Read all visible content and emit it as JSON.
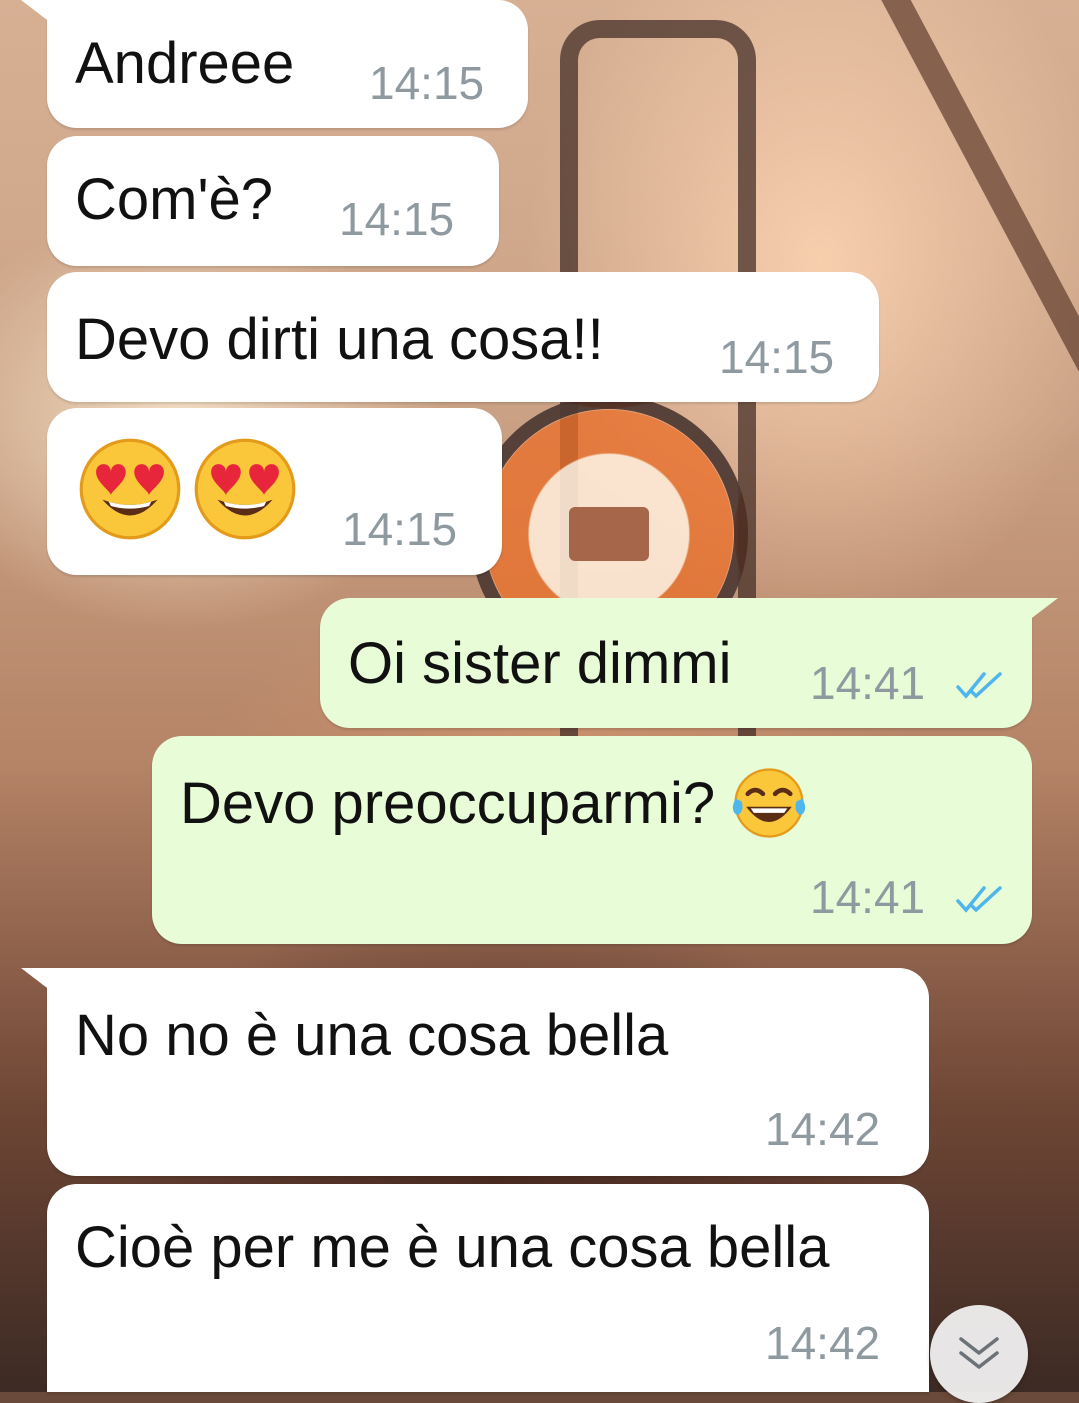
{
  "messages": [
    {
      "direction": "incoming",
      "text": "Andreee",
      "time": "14:15"
    },
    {
      "direction": "incoming",
      "text": "Com'è?",
      "time": "14:15"
    },
    {
      "direction": "incoming",
      "text": "Devo dirti una cosa!!",
      "time": "14:15"
    },
    {
      "direction": "incoming",
      "emoji": [
        "heart-eyes-emoji",
        "heart-eyes-emoji"
      ],
      "time": "14:15"
    },
    {
      "direction": "outgoing",
      "text": "Oi sister dimmi",
      "time": "14:41",
      "status": "read"
    },
    {
      "direction": "outgoing",
      "text": "Devo preoccuparmi?",
      "emoji": [
        "tears-of-joy-emoji"
      ],
      "time": "14:41",
      "status": "read"
    },
    {
      "direction": "incoming",
      "text": "No no è una cosa bella",
      "time": "14:42"
    },
    {
      "direction": "incoming",
      "text": "Cioè per me è una cosa bella",
      "time": "14:42"
    }
  ],
  "scroll_button": {
    "icon": "double-chevron-down-icon"
  },
  "colors": {
    "incoming_bubble": "#ffffff",
    "outgoing_bubble": "#e7fcd7",
    "timestamp": "#8f9aa0",
    "read_check": "#4fb6ec"
  }
}
